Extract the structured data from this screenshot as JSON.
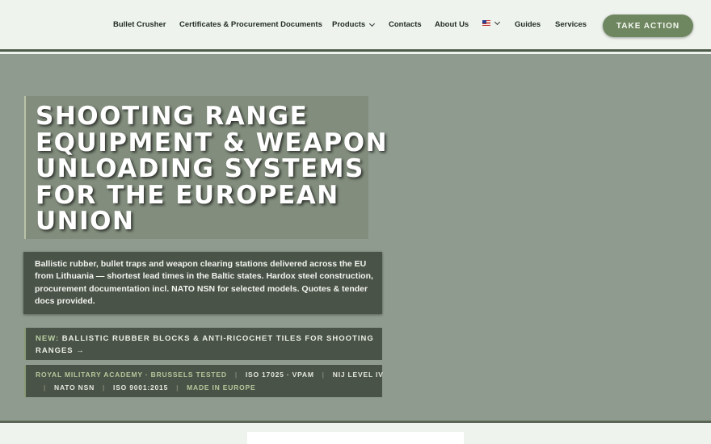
{
  "nav": {
    "items": [
      {
        "label": "Bullet Crusher",
        "dropdown": false
      },
      {
        "label": "Certificates & Procurement Documents",
        "dropdown": false
      },
      {
        "label": "Products",
        "dropdown": true
      },
      {
        "label": "Contacts",
        "dropdown": false
      },
      {
        "label": "About Us",
        "dropdown": false
      },
      {
        "label": "",
        "dropdown": true,
        "icon": "us-flag-icon"
      },
      {
        "label": "Guides",
        "dropdown": false
      },
      {
        "label": "Services",
        "dropdown": false
      }
    ],
    "cta_label": "TAKE ACTION"
  },
  "hero": {
    "title": "SHOOTING RANGE EQUIPMENT & WEAPON UNLOADING SYSTEMS FOR THE EUROPEAN UNION",
    "description": "Ballistic rubber, bullet traps and weapon clearing stations delivered across the EU from Lithuania — shortest lead times in the Baltic states. Hardox steel construction, procurement documentation incl. NATO NSN for selected models. Quotes & tender docs provided.",
    "news_tag": "NEW:",
    "news_text": "BALLISTIC RUBBER BLOCKS & ANTI-RICOCHET TILES FOR SHOOTING RANGES →",
    "certs": {
      "line1": [
        "ROYAL MILITARY ACADEMY · BRUSSELS TESTED",
        "ISO 17025 · VPAM",
        "NIJ LEVEL IV"
      ],
      "line2": [
        "NATO NSN",
        "ISO 9001:2015",
        "MADE IN EUROPE"
      ]
    }
  },
  "colors": {
    "hero_bg": "#8f9b8f",
    "cta_bg": "#6f8760",
    "panel_bg": "#4a5347",
    "accent_green": "#b6c79c"
  }
}
